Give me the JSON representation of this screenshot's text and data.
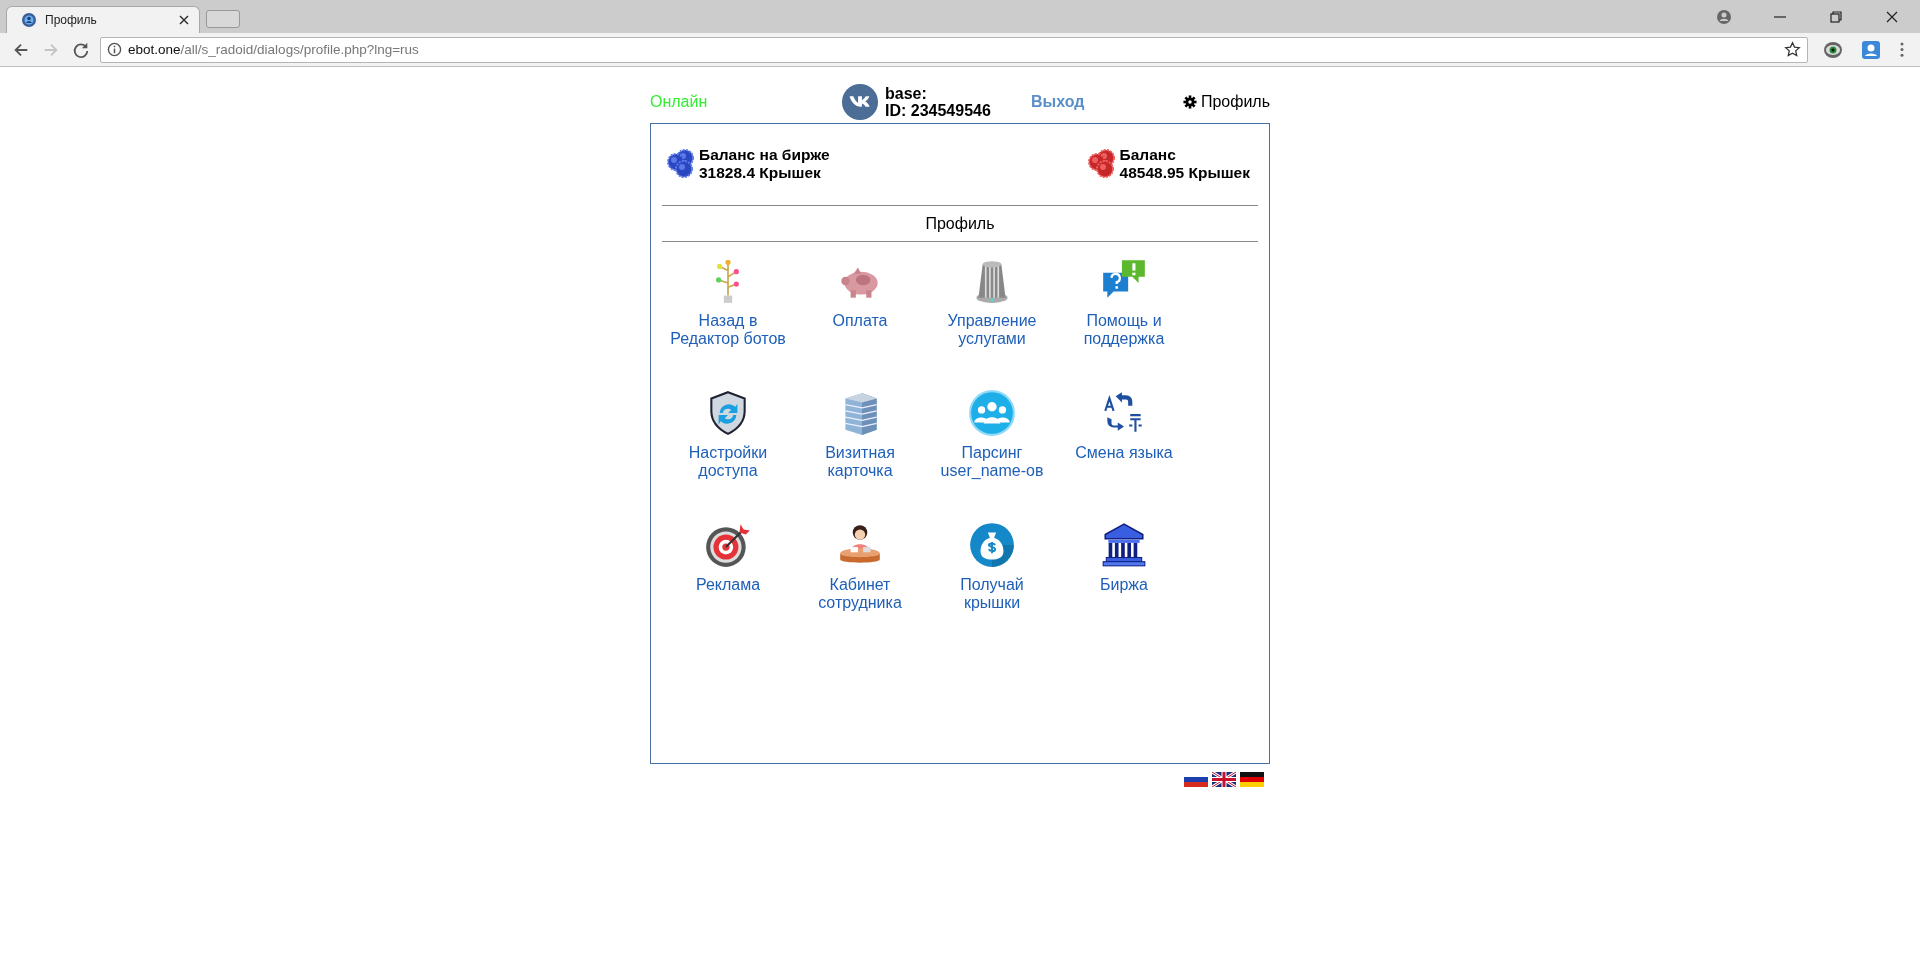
{
  "browser": {
    "tabs": [
      {
        "kind": "page",
        "title": "Профиль",
        "selected": true
      },
      {
        "kind": "new",
        "selected": false
      }
    ],
    "address": {
      "host": "ebot.one",
      "path": "/all/s_radoid/dialogs/profile.php?lng=rus"
    }
  },
  "header": {
    "status": "Онлайн",
    "user_name": "base:",
    "user_id": "ID: 234549546",
    "logout": "Выход",
    "profile": "Профиль"
  },
  "balances": [
    {
      "kind": "exchange",
      "title": "Баланс на бирже",
      "amount": "31828.4 Крышек"
    },
    {
      "kind": "main",
      "title": "Баланс",
      "amount": "48548.95 Крышек"
    }
  ],
  "section_title": "Профиль",
  "menu": [
    {
      "kind": "tree",
      "label": "Назад в\nРедактор ботов"
    },
    {
      "kind": "piggy",
      "label": "Оплата"
    },
    {
      "kind": "knob",
      "label": "Управление\nуслугами"
    },
    {
      "kind": "help",
      "label": "Помощь и\nподдержка"
    },
    {
      "kind": "shield",
      "label": "Настройки\nдоступа"
    },
    {
      "kind": "building",
      "label": "Визитная\nкарточка"
    },
    {
      "kind": "people",
      "label": "Парсинг\nuser_name-ов"
    },
    {
      "kind": "translate",
      "label": "Смена языка"
    },
    {
      "kind": "target",
      "label": "Реклама"
    },
    {
      "kind": "desk",
      "label": "Кабинет\nсотрудника"
    },
    {
      "kind": "moneybag",
      "label": "Получай\nкрышки"
    },
    {
      "kind": "bank",
      "label": "Биржа"
    }
  ],
  "languages": [
    {
      "kind": "ru"
    },
    {
      "kind": "en"
    },
    {
      "kind": "de"
    }
  ]
}
